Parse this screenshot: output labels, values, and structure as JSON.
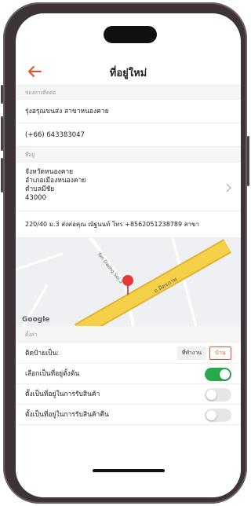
{
  "header": {
    "title": "ที่อยู่ใหม่"
  },
  "contact": {
    "section_label": "ช่องทางติดต่อ",
    "name": "รุ่งอรุณขนส่ง สาขาหนองคาย",
    "phone": "(+66) 643383047"
  },
  "address": {
    "section_label": "ที่อยู่",
    "province": "จังหวัดหนองคาย",
    "district": "อำเภอเมืองหนองคาย",
    "subdistrict": "ตำบลมีชัย",
    "postcode": "43000",
    "detail": "220/40 ม.3 ส่งต่อคุณ ณัฐนนท์ โทร +8562051238789 สาขา"
  },
  "map": {
    "road_label": "ถ.มิตรภาพ",
    "soi_label": "Ton Daeng Soi 3",
    "google_logo": "Google",
    "colors": {
      "road": "#f5d14a",
      "road_edge": "#e3b22e",
      "pin": "#e53935",
      "bg": "#eef0f3"
    }
  },
  "settings": {
    "section_label": "ตั้งค่า",
    "label_as": "ติดป้ายเป็น:",
    "work_button": "ที่ทำงาน",
    "home_button": "บ้าน",
    "default_address": "เลือกเป็นที่อยู่ตั้งต้น",
    "pickup_address": "ตั้งเป็นที่อยู่ในการรับสินค้า",
    "return_address": "ตั้งเป็นที่อยู่ในการรับสินค้าคืน",
    "toggles": {
      "default": true,
      "pickup": false,
      "return": false
    }
  },
  "colors": {
    "accent": "#ee4d2d",
    "toggle_on": "#26aa4c",
    "toggle_off": "#e6e6e6"
  }
}
